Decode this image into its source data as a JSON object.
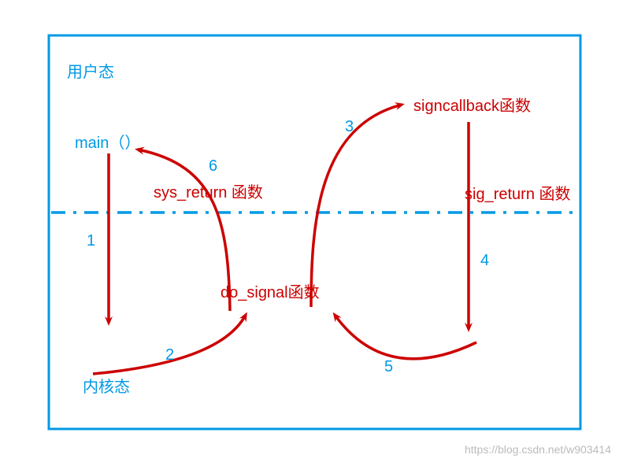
{
  "labels": {
    "user_mode": "用户态",
    "kernel_mode": "内核态",
    "main": "main（）",
    "signcallback": "signcallback函数",
    "do_signal": "do_signal函数",
    "sys_return": "sys_return 函数",
    "sig_return": "sig_return 函数",
    "n1": "1",
    "n2": "2",
    "n3": "3",
    "n4": "4",
    "n5": "5",
    "n6": "6"
  },
  "watermark": "https://blog.csdn.net/w903414",
  "colors": {
    "blue": "#0099e5",
    "red": "#cc0000"
  }
}
